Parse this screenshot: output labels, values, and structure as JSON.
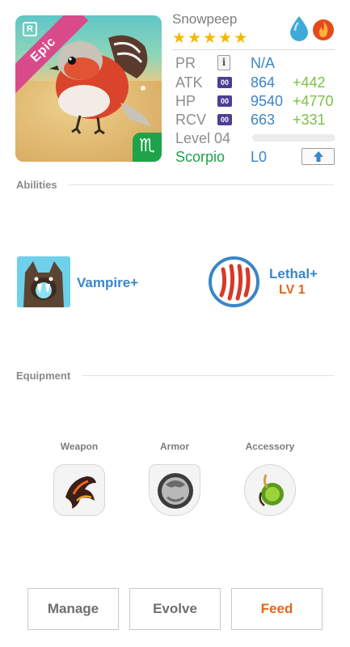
{
  "monster": {
    "name": "Snowpeep",
    "rarity": "Epic",
    "badge_letter": "R",
    "star_count": 5,
    "stars": [
      "★",
      "★",
      "★",
      "★",
      "★"
    ],
    "elements": [
      "water-drop-icon",
      "fire-icon"
    ],
    "sign_glyph": "♏"
  },
  "stats": {
    "pr": {
      "label": "PR",
      "value": "N/A",
      "info_glyph": "i"
    },
    "atk": {
      "label": "ATK",
      "badge": "00",
      "value": "864",
      "bonus": "+442"
    },
    "hp": {
      "label": "HP",
      "badge": "00",
      "value": "9540",
      "bonus": "+4770"
    },
    "rcv": {
      "label": "RCV",
      "badge": "00",
      "value": "663",
      "bonus": "+331"
    },
    "level": {
      "label": "Level 04",
      "progress": 0
    },
    "sign": {
      "label": "Scorpio",
      "value": "L0"
    }
  },
  "abilities": {
    "title": "Abilities",
    "items": [
      {
        "name": "Vampire+",
        "icon": "vampire-wolf-icon"
      },
      {
        "name": "Lethal+",
        "level": "LV 1",
        "icon": "claw-slash-icon"
      }
    ]
  },
  "equipment": {
    "title": "Equipment",
    "slots": [
      {
        "label": "Weapon",
        "icon": "lava-claw-icon"
      },
      {
        "label": "Armor",
        "icon": "steel-armor-icon"
      },
      {
        "label": "Accessory",
        "icon": "green-charm-icon"
      }
    ]
  },
  "actions": {
    "manage": "Manage",
    "evolve": "Evolve",
    "feed": "Feed"
  },
  "colors": {
    "accent_blue": "#3a86c8",
    "bonus_green": "#7ac143",
    "sign_green": "#1da34a",
    "feed_orange": "#e2661b",
    "epic_pink": "#d94a8a",
    "star_gold": "#f5b800"
  }
}
